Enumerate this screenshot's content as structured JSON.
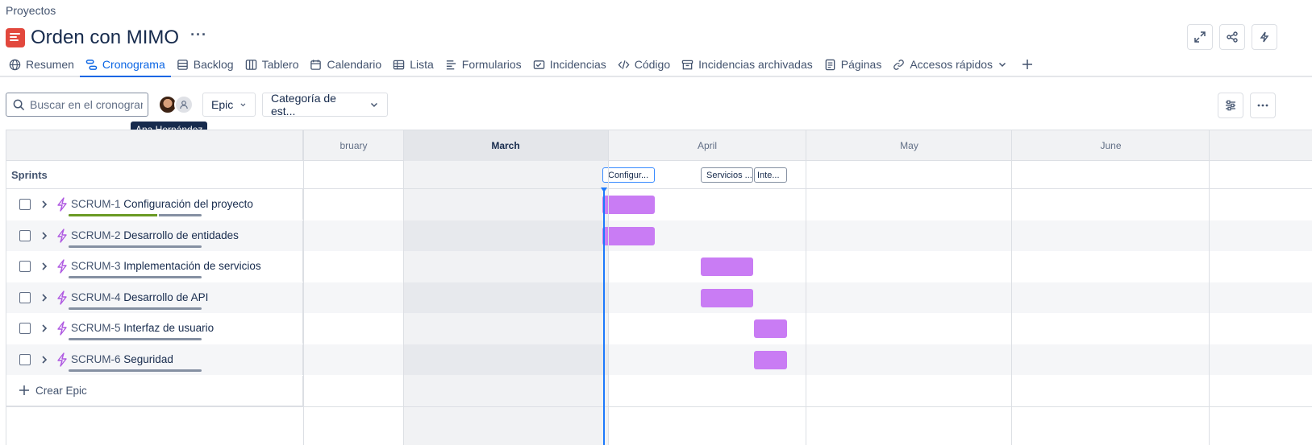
{
  "breadcrumb": "Proyectos",
  "project": {
    "title": "Orden con MIMO",
    "more": "···"
  },
  "tabs": [
    {
      "label": "Resumen",
      "icon": "globe-icon"
    },
    {
      "label": "Cronograma",
      "icon": "timeline-icon",
      "active": true
    },
    {
      "label": "Backlog",
      "icon": "backlog-icon"
    },
    {
      "label": "Tablero",
      "icon": "board-icon"
    },
    {
      "label": "Calendario",
      "icon": "calendar-icon"
    },
    {
      "label": "Lista",
      "icon": "list-icon"
    },
    {
      "label": "Formularios",
      "icon": "forms-icon"
    },
    {
      "label": "Incidencias",
      "icon": "issues-icon"
    },
    {
      "label": "Código",
      "icon": "code-icon"
    },
    {
      "label": "Incidencias archivadas",
      "icon": "archive-icon"
    },
    {
      "label": "Páginas",
      "icon": "pages-icon"
    },
    {
      "label": "Accesos rápidos",
      "icon": "link-icon"
    }
  ],
  "toolbar": {
    "search_placeholder": "Buscar en el cronograma",
    "epic_filter": "Epic",
    "category_filter": "Categoría de est...",
    "tooltip": "Ana Hernández"
  },
  "timeline": {
    "months": [
      "bruary",
      "March",
      "April",
      "May",
      "June"
    ],
    "current_month": "March",
    "sprints_label": "Sprints",
    "sprints": [
      "Configur...",
      "Servicios ...",
      "Inte..."
    ],
    "epics": [
      {
        "key": "SCRUM-1",
        "title": "Configuración del proyecto",
        "progress": 0.67
      },
      {
        "key": "SCRUM-2",
        "title": "Desarrollo de entidades",
        "progress": 0
      },
      {
        "key": "SCRUM-3",
        "title": "Implementación de servicios",
        "progress": 0
      },
      {
        "key": "SCRUM-4",
        "title": "Desarrollo de API",
        "progress": 0
      },
      {
        "key": "SCRUM-5",
        "title": "Interfaz de usuario",
        "progress": 0
      },
      {
        "key": "SCRUM-6",
        "title": "Seguridad",
        "progress": 0
      }
    ],
    "create_label": "Crear Epic"
  },
  "colors": {
    "accent": "#0c66e4",
    "epic_bar": "#c97cf4",
    "epic_icon": "#af59e1",
    "progress_done": "#6a9a23",
    "today": "#1d7afc"
  }
}
